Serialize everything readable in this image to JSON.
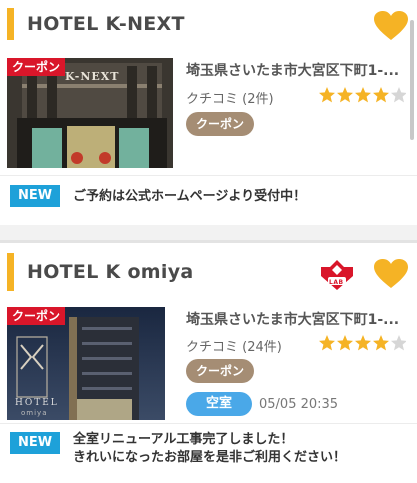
{
  "listings": [
    {
      "name": "HOTEL K-NEXT",
      "coupon_tag": "クーポン",
      "address": "埼玉県さいたま市大宮区下町1-...",
      "review": "クチコミ (2件)",
      "rating": 4.5,
      "coupon_label": "クーポン",
      "new_label": "NEW",
      "notice": "ご予約は公式ホームページより受付中！",
      "photo_sign": "K-NEXT"
    },
    {
      "name": "HOTEL K omiya",
      "coupon_tag": "クーポン",
      "address": "埼玉県さいたま市大宮区下町1-...",
      "review": "クチコミ (24件)",
      "rating": 4.5,
      "coupon_label": "クーポン",
      "vacancy_label": "空室",
      "vacancy_time": "05/05 20:35",
      "new_label": "NEW",
      "notice_line1": "全室リニューアル工事完了しました！",
      "notice_line2": "きれいになったお部屋を是非ご利用ください！",
      "photo_sign": "HOTEL",
      "photo_sign_sub": "omiya",
      "badge_text": "LAB"
    }
  ],
  "colors": {
    "accent": "#f5b325",
    "coupon_red": "#d9162a",
    "coupon_brown": "#a58d74",
    "vacancy_blue": "#4aa8e8",
    "new_blue": "#1ea1d9"
  }
}
